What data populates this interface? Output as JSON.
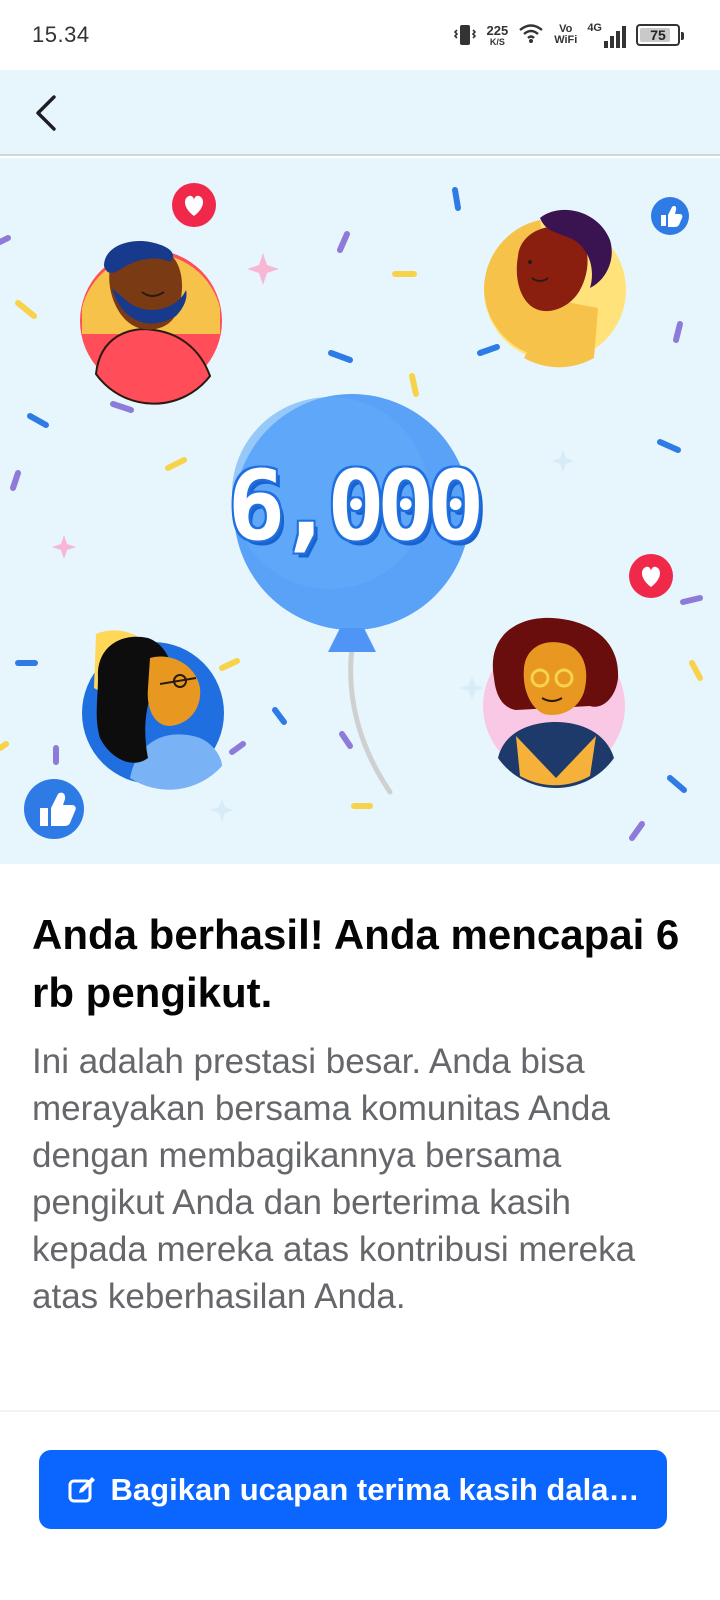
{
  "status_bar": {
    "time": "15.34",
    "net_speed_value": "225",
    "net_speed_unit": "K/S",
    "vowifi_top": "Vo",
    "vowifi_bottom": "WiFi",
    "network_type": "4G",
    "battery_level": "75",
    "icons": [
      "vibrate-icon",
      "wifi-icon",
      "signal-icon",
      "battery-icon"
    ]
  },
  "header": {
    "back_icon": "chevron-left-icon"
  },
  "hero": {
    "milestone": "6,000",
    "accent_color": "#4f95f5",
    "background_color": "#e7f6fc",
    "icons": [
      "heart-icon",
      "like-thumb-icon",
      "balloon-illustration",
      "avatar-illustration"
    ]
  },
  "content": {
    "headline": "Anda berhasil! Anda mencapai 6 rb pengikut.",
    "body": "Ini adalah prestasi besar. Anda bisa merayakan bersama komunitas Anda dengan membagikannya bersama pengikut Anda dan berterima kasih kepada mereka atas kontribusi mereka atas keberhasilan Anda."
  },
  "share_button": {
    "label": "Bagikan ucapan terima kasih dala…",
    "icon": "edit-icon",
    "color": "#0b66ff"
  }
}
